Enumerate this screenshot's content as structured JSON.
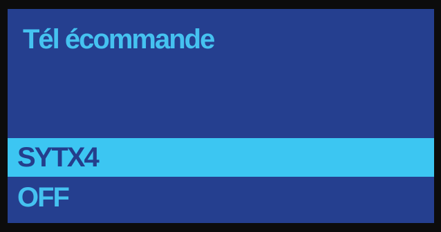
{
  "screen": {
    "title": "Tél écommande",
    "items": [
      {
        "label": "SYTX4",
        "selected": true
      },
      {
        "label": "OFF",
        "selected": false
      }
    ]
  },
  "colors": {
    "background": "#253f8f",
    "text": "#45c2f0",
    "highlight": "#3cc6f2",
    "highlight_text": "#243e8c",
    "bezel": "#0c0c0c"
  }
}
